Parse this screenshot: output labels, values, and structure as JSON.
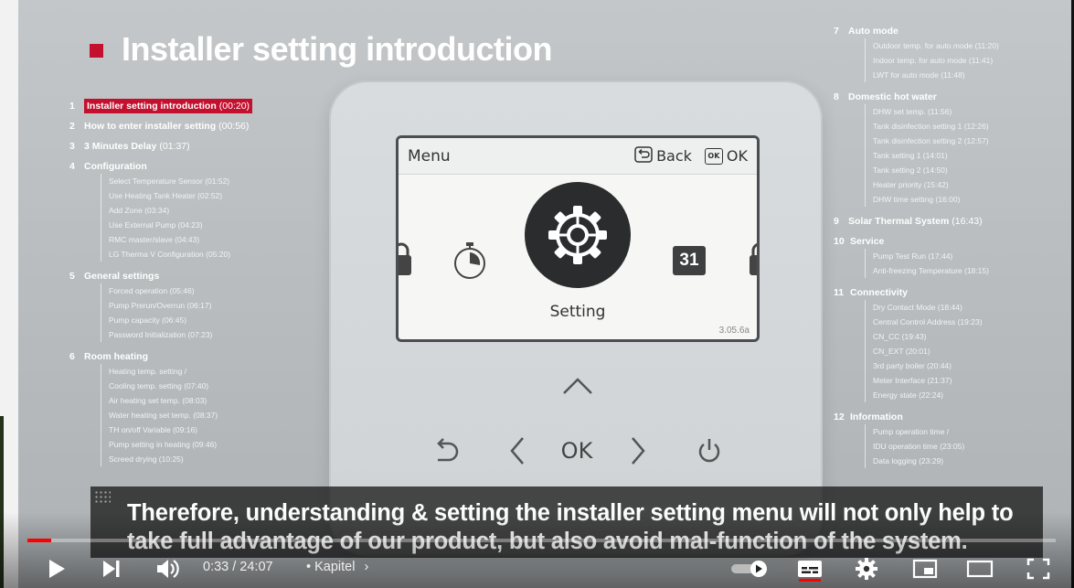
{
  "slide": {
    "title": "Installer setting introduction"
  },
  "toc_left": [
    {
      "num": "1",
      "label": "Installer setting introduction",
      "time": "(00:20)",
      "highlight": true,
      "subs": []
    },
    {
      "num": "2",
      "label": "How to enter installer setting",
      "time": "(00:56)",
      "highlight": false,
      "subs": []
    },
    {
      "num": "3",
      "label": "3 Minutes Delay",
      "time": "(01:37)",
      "highlight": false,
      "subs": []
    },
    {
      "num": "4",
      "label": "Configuration",
      "time": "",
      "highlight": false,
      "subs": [
        "Select Temperature Sensor (01:52)",
        "Use Heating Tank Heater (02:52)",
        "Add Zone (03:34)",
        "Use External Pump (04:23)",
        "RMC master/slave (04:43)",
        "LG Therma V Configuration (05:20)"
      ]
    },
    {
      "num": "5",
      "label": "General settings",
      "time": "",
      "highlight": false,
      "subs": [
        "Forced operation (05:46)",
        "Pump Prerun/Overrun (06:17)",
        "Pump capacity (06:45)",
        "Password Initialization (07:23)"
      ]
    },
    {
      "num": "6",
      "label": "Room heating",
      "time": "",
      "highlight": false,
      "subs": [
        "Heating temp. setting /",
        "Cooling temp. setting (07:40)",
        "Air heating set temp. (08:03)",
        "Water heating set temp. (08:37)",
        "TH on/off Variable (09:16)",
        "Pump setting in heating (09:46)",
        "Screed drying (10:25)"
      ]
    }
  ],
  "toc_right": [
    {
      "num": "7",
      "label": "Auto mode",
      "time": "",
      "subs": [
        "Outdoor temp. for auto mode (11:20)",
        "Indoor temp. for auto mode (11:41)",
        "LWT for auto mode (11:48)"
      ]
    },
    {
      "num": "8",
      "label": "Domestic hot water",
      "time": "",
      "subs": [
        "DHW set temp. (11:56)",
        "Tank disinfection setting 1 (12:26)",
        "Tank disinfection setting 2 (12:57)",
        "Tank setting 1 (14:01)",
        "Tank setting 2 (14:50)",
        "Heater priority (15:42)",
        "DHW time setting (16:00)"
      ]
    },
    {
      "num": "9",
      "label": "Solar Thermal System",
      "time": "(16:43)",
      "subs": []
    },
    {
      "num": "10",
      "label": "Service",
      "time": "",
      "subs": [
        "Pump Test Run (17:44)",
        "Anti-freezing Temperature (18:15)"
      ]
    },
    {
      "num": "11",
      "label": "Connectivity",
      "time": "",
      "subs": [
        "Dry Contact Mode (18:44)",
        "Central Control Address (19:23)",
        "CN_CC (19:43)",
        "CN_EXT (20:01)",
        "3rd party boiler (20:44)",
        "Meter Interface (21:37)",
        "Energy state (22:24)"
      ]
    },
    {
      "num": "12",
      "label": "Information",
      "time": "",
      "subs": [
        "Pump operation time /",
        "IDU operation time (23:05)",
        "Data logging (23:29)"
      ]
    }
  ],
  "device": {
    "screen_title": "Menu",
    "back_label": "Back",
    "ok_label": "OK",
    "ok_box": "OK",
    "selected_item": "Setting",
    "calendar_day": "31",
    "version": "3.05.6a",
    "ok_button": "OK"
  },
  "subtitle": "Therefore, understanding & setting the installer setting menu will not only help to take full advantage of our product, but also avoid mal-function of the system.",
  "player": {
    "current_time": "0:33",
    "duration": "24:07",
    "time_display": "0:33 / 24:07",
    "chapter_label": "• Kapitel",
    "progress_fraction": 0.0228,
    "accent_color": "#ff0000"
  },
  "colors": {
    "slide_accent": "#c3102e"
  }
}
